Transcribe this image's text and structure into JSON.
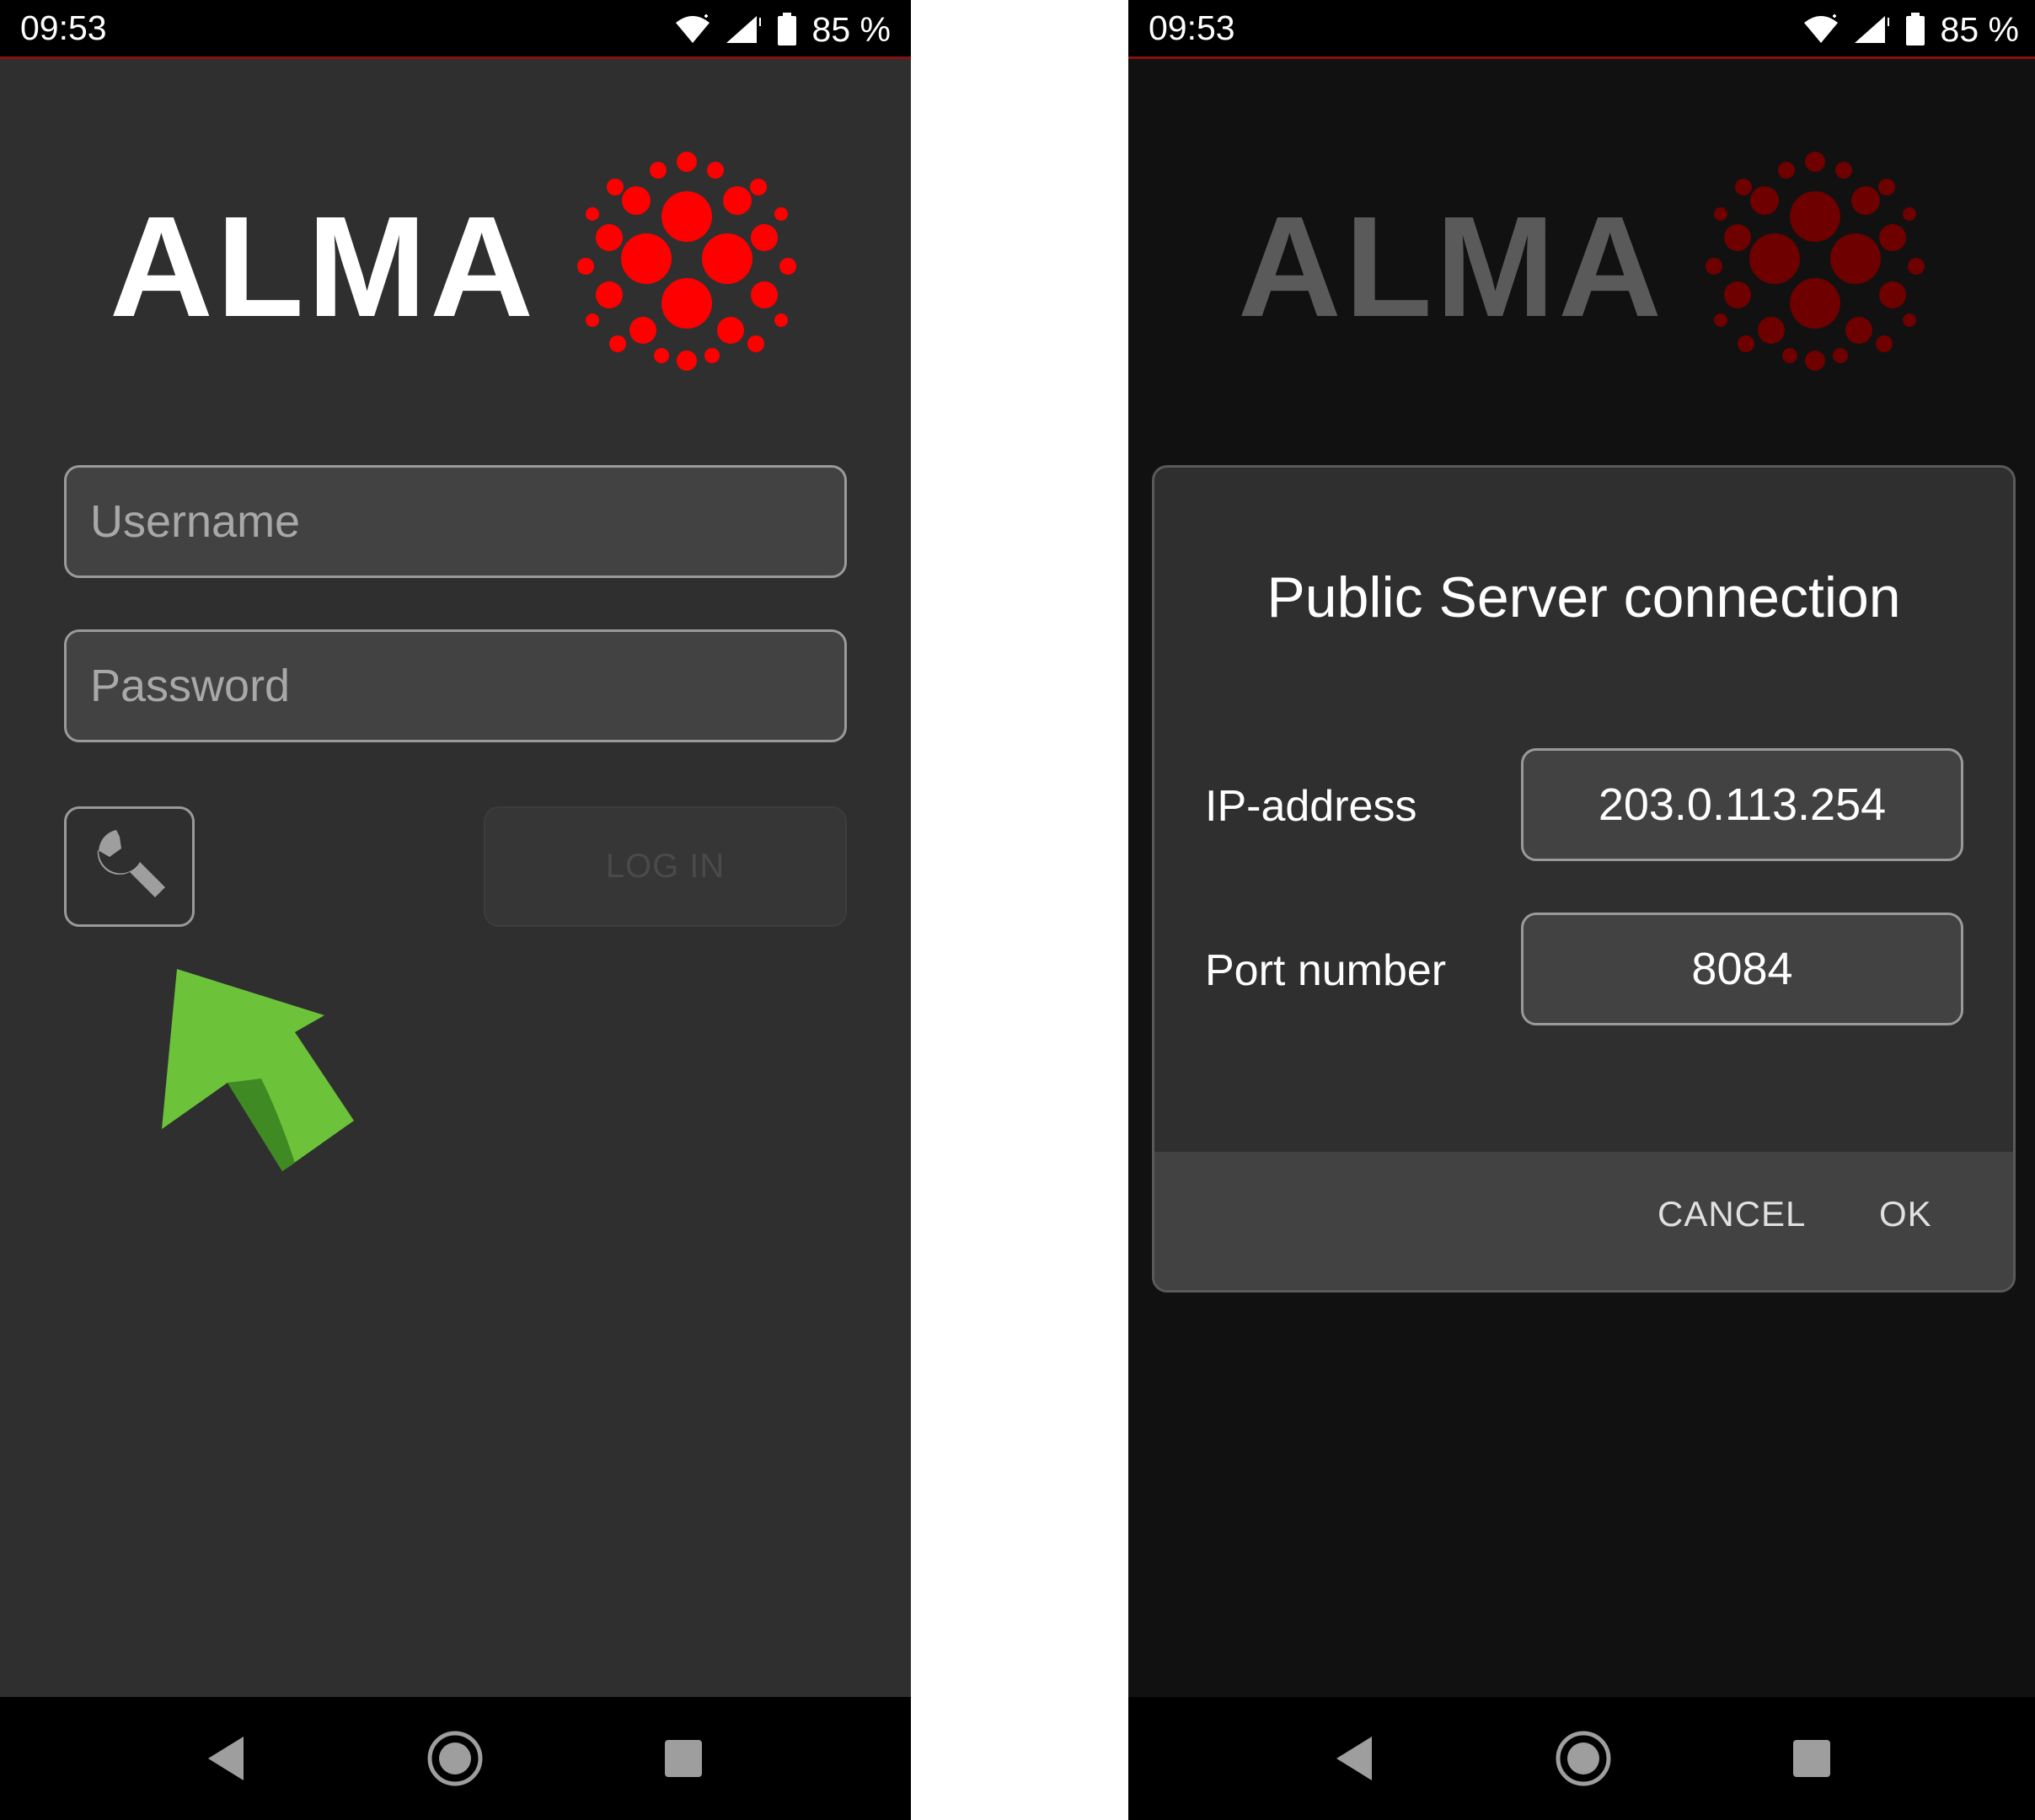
{
  "status_bar": {
    "time": "09:53",
    "battery": "85 %"
  },
  "brand": {
    "name": "ALMA",
    "accent_color": "#ff0000",
    "dim_accent_color": "#6e0000"
  },
  "login_screen": {
    "username_placeholder": "Username",
    "password_placeholder": "Password",
    "settings_button_icon": "wrench-icon",
    "login_label": "LOG IN",
    "hint_arrow_color": "#5db830"
  },
  "server_dialog": {
    "title": "Public Server connection",
    "ip_label": "IP-address",
    "ip_value": "203.0.113.254",
    "port_label": "Port number",
    "port_value": "8084",
    "cancel_label": "CANCEL",
    "ok_label": "OK"
  },
  "nav_bar": {
    "icons": [
      "back-icon",
      "home-icon",
      "recents-icon"
    ]
  }
}
